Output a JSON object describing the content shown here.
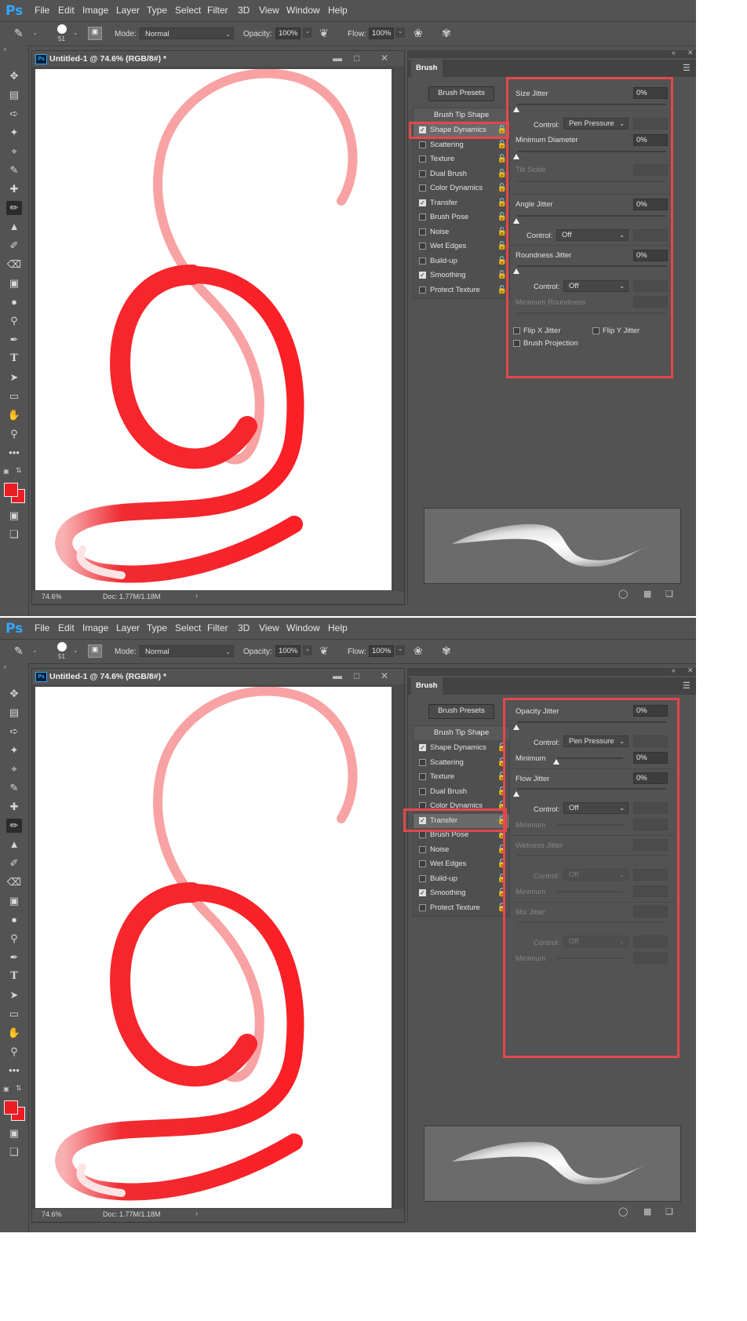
{
  "app": {
    "logo": "Ps",
    "menu": [
      "File",
      "Edit",
      "Image",
      "Layer",
      "Type",
      "Select",
      "Filter",
      "3D",
      "View",
      "Window",
      "Help"
    ],
    "options_bar": {
      "brush_size": "51",
      "mode_label": "Mode:",
      "mode_value": "Normal",
      "opacity_label": "Opacity:",
      "opacity_value": "100%",
      "flow_label": "Flow:",
      "flow_value": "100%"
    },
    "document": {
      "title": "Untitled-1 @ 74.6% (RGB/8#) *",
      "zoom": "74.6%",
      "doc_size": "Doc: 1.77M/1.18M"
    },
    "colors": {
      "foreground": "#ec1c24",
      "background": "#ec1c24",
      "highlight": "#e4474c",
      "accent": "#31a8ff"
    }
  },
  "brush_panel": {
    "tab": "Brush",
    "presets_button": "Brush Presets",
    "tip_shape": "Brush Tip Shape",
    "items": [
      {
        "label": "Shape Dynamics",
        "checked": true
      },
      {
        "label": "Scattering",
        "checked": false
      },
      {
        "label": "Texture",
        "checked": false
      },
      {
        "label": "Dual Brush",
        "checked": false
      },
      {
        "label": "Color Dynamics",
        "checked": false
      },
      {
        "label": "Transfer",
        "checked": true
      },
      {
        "label": "Brush Pose",
        "checked": false
      },
      {
        "label": "Noise",
        "checked": false
      },
      {
        "label": "Wet Edges",
        "checked": false
      },
      {
        "label": "Build-up",
        "checked": false
      },
      {
        "label": "Smoothing",
        "checked": true
      },
      {
        "label": "Protect Texture",
        "checked": false
      }
    ]
  },
  "shape_dynamics": {
    "size_jitter_label": "Size Jitter",
    "size_jitter_value": "0%",
    "control_label": "Control:",
    "control_1": "Pen Pressure",
    "min_diameter_label": "Minimum Diameter",
    "min_diameter_value": "0%",
    "tilt_scale_label": "Tilt Scale",
    "angle_jitter_label": "Angle Jitter",
    "angle_jitter_value": "0%",
    "control_2": "Off",
    "roundness_jitter_label": "Roundness Jitter",
    "roundness_jitter_value": "0%",
    "control_3": "Off",
    "min_roundness_label": "Minimum Roundness",
    "flip_x_label": "Flip X Jitter",
    "flip_y_label": "Flip Y Jitter",
    "projection_label": "Brush Projection"
  },
  "transfer": {
    "opacity_jitter_label": "Opacity Jitter",
    "opacity_jitter_value": "0%",
    "control_label": "Control:",
    "control_1": "Pen Pressure",
    "minimum_label": "Minimum",
    "minimum_value": "0%",
    "flow_jitter_label": "Flow Jitter",
    "flow_jitter_value": "0%",
    "control_2": "Off",
    "wetness_jitter_label": "Wetness Jitter",
    "control_3": "Off",
    "mix_jitter_label": "Mix Jitter",
    "control_4": "Off"
  }
}
